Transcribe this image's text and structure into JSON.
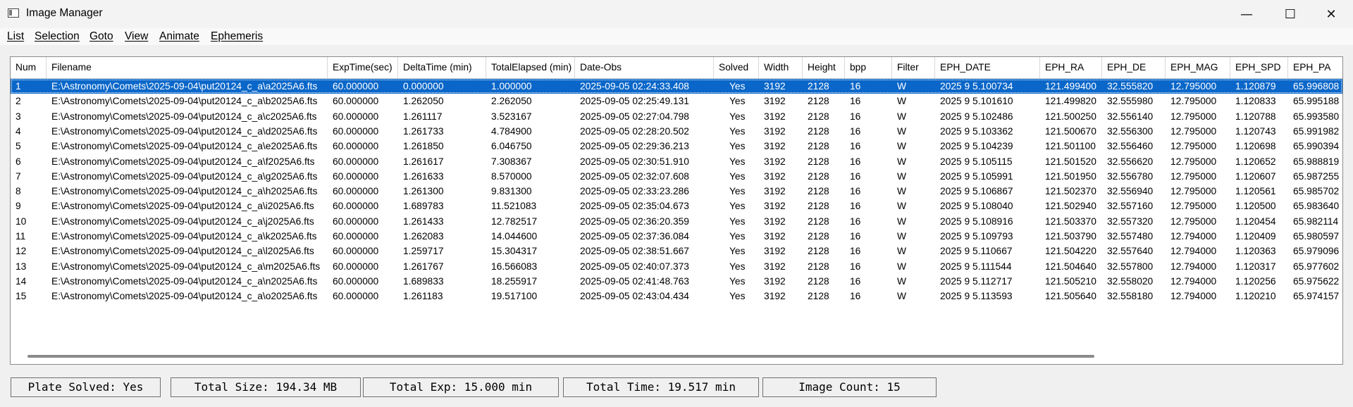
{
  "window": {
    "title": "Image Manager",
    "controls": [
      "—",
      "☐",
      "✕"
    ]
  },
  "menu": [
    "List",
    "Selection",
    "Goto",
    "View",
    "Animate",
    "Ephemeris"
  ],
  "table": {
    "columns": [
      "Num",
      "Filename",
      "ExpTime(sec)",
      "DeltaTime (min)",
      "TotalElapsed (min)",
      "Date-Obs",
      "Solved",
      "Width",
      "Height",
      "bpp",
      "Filter",
      "EPH_DATE",
      "EPH_RA",
      "EPH_DE",
      "EPH_MAG",
      "EPH_SPD",
      "EPH_PA"
    ],
    "selected_row": 0,
    "rows": [
      [
        "1",
        "E:\\Astronomy\\Comets\\2025-09-04\\put20124_c_a\\a2025A6.fts",
        "60.000000",
        "0.000000",
        "1.000000",
        "2025-09-05 02:24:33.408",
        "Yes",
        "3192",
        "2128",
        "16",
        "W",
        "2025 9 5.100734",
        "121.499400",
        "32.555820",
        "12.795000",
        "1.120879",
        "65.996808"
      ],
      [
        "2",
        "E:\\Astronomy\\Comets\\2025-09-04\\put20124_c_a\\b2025A6.fts",
        "60.000000",
        "1.262050",
        "2.262050",
        "2025-09-05 02:25:49.131",
        "Yes",
        "3192",
        "2128",
        "16",
        "W",
        "2025 9 5.101610",
        "121.499820",
        "32.555980",
        "12.795000",
        "1.120833",
        "65.995188"
      ],
      [
        "3",
        "E:\\Astronomy\\Comets\\2025-09-04\\put20124_c_a\\c2025A6.fts",
        "60.000000",
        "1.261117",
        "3.523167",
        "2025-09-05 02:27:04.798",
        "Yes",
        "3192",
        "2128",
        "16",
        "W",
        "2025 9 5.102486",
        "121.500250",
        "32.556140",
        "12.795000",
        "1.120788",
        "65.993580"
      ],
      [
        "4",
        "E:\\Astronomy\\Comets\\2025-09-04\\put20124_c_a\\d2025A6.fts",
        "60.000000",
        "1.261733",
        "4.784900",
        "2025-09-05 02:28:20.502",
        "Yes",
        "3192",
        "2128",
        "16",
        "W",
        "2025 9 5.103362",
        "121.500670",
        "32.556300",
        "12.795000",
        "1.120743",
        "65.991982"
      ],
      [
        "5",
        "E:\\Astronomy\\Comets\\2025-09-04\\put20124_c_a\\e2025A6.fts",
        "60.000000",
        "1.261850",
        "6.046750",
        "2025-09-05 02:29:36.213",
        "Yes",
        "3192",
        "2128",
        "16",
        "W",
        "2025 9 5.104239",
        "121.501100",
        "32.556460",
        "12.795000",
        "1.120698",
        "65.990394"
      ],
      [
        "6",
        "E:\\Astronomy\\Comets\\2025-09-04\\put20124_c_a\\f2025A6.fts",
        "60.000000",
        "1.261617",
        "7.308367",
        "2025-09-05 02:30:51.910",
        "Yes",
        "3192",
        "2128",
        "16",
        "W",
        "2025 9 5.105115",
        "121.501520",
        "32.556620",
        "12.795000",
        "1.120652",
        "65.988819"
      ],
      [
        "7",
        "E:\\Astronomy\\Comets\\2025-09-04\\put20124_c_a\\g2025A6.fts",
        "60.000000",
        "1.261633",
        "8.570000",
        "2025-09-05 02:32:07.608",
        "Yes",
        "3192",
        "2128",
        "16",
        "W",
        "2025 9 5.105991",
        "121.501950",
        "32.556780",
        "12.795000",
        "1.120607",
        "65.987255"
      ],
      [
        "8",
        "E:\\Astronomy\\Comets\\2025-09-04\\put20124_c_a\\h2025A6.fts",
        "60.000000",
        "1.261300",
        "9.831300",
        "2025-09-05 02:33:23.286",
        "Yes",
        "3192",
        "2128",
        "16",
        "W",
        "2025 9 5.106867",
        "121.502370",
        "32.556940",
        "12.795000",
        "1.120561",
        "65.985702"
      ],
      [
        "9",
        "E:\\Astronomy\\Comets\\2025-09-04\\put20124_c_a\\i2025A6.fts",
        "60.000000",
        "1.689783",
        "11.521083",
        "2025-09-05 02:35:04.673",
        "Yes",
        "3192",
        "2128",
        "16",
        "W",
        "2025 9 5.108040",
        "121.502940",
        "32.557160",
        "12.795000",
        "1.120500",
        "65.983640"
      ],
      [
        "10",
        "E:\\Astronomy\\Comets\\2025-09-04\\put20124_c_a\\j2025A6.fts",
        "60.000000",
        "1.261433",
        "12.782517",
        "2025-09-05 02:36:20.359",
        "Yes",
        "3192",
        "2128",
        "16",
        "W",
        "2025 9 5.108916",
        "121.503370",
        "32.557320",
        "12.795000",
        "1.120454",
        "65.982114"
      ],
      [
        "11",
        "E:\\Astronomy\\Comets\\2025-09-04\\put20124_c_a\\k2025A6.fts",
        "60.000000",
        "1.262083",
        "14.044600",
        "2025-09-05 02:37:36.084",
        "Yes",
        "3192",
        "2128",
        "16",
        "W",
        "2025 9 5.109793",
        "121.503790",
        "32.557480",
        "12.794000",
        "1.120409",
        "65.980597"
      ],
      [
        "12",
        "E:\\Astronomy\\Comets\\2025-09-04\\put20124_c_a\\l2025A6.fts",
        "60.000000",
        "1.259717",
        "15.304317",
        "2025-09-05 02:38:51.667",
        "Yes",
        "3192",
        "2128",
        "16",
        "W",
        "2025 9 5.110667",
        "121.504220",
        "32.557640",
        "12.794000",
        "1.120363",
        "65.979096"
      ],
      [
        "13",
        "E:\\Astronomy\\Comets\\2025-09-04\\put20124_c_a\\m2025A6.fts",
        "60.000000",
        "1.261767",
        "16.566083",
        "2025-09-05 02:40:07.373",
        "Yes",
        "3192",
        "2128",
        "16",
        "W",
        "2025 9 5.111544",
        "121.504640",
        "32.557800",
        "12.794000",
        "1.120317",
        "65.977602"
      ],
      [
        "14",
        "E:\\Astronomy\\Comets\\2025-09-04\\put20124_c_a\\n2025A6.fts",
        "60.000000",
        "1.689833",
        "18.255917",
        "2025-09-05 02:41:48.763",
        "Yes",
        "3192",
        "2128",
        "16",
        "W",
        "2025 9 5.112717",
        "121.505210",
        "32.558020",
        "12.794000",
        "1.120256",
        "65.975622"
      ],
      [
        "15",
        "E:\\Astronomy\\Comets\\2025-09-04\\put20124_c_a\\o2025A6.fts",
        "60.000000",
        "1.261183",
        "19.517100",
        "2025-09-05 02:43:04.434",
        "Yes",
        "3192",
        "2128",
        "16",
        "W",
        "2025 9 5.113593",
        "121.505640",
        "32.558180",
        "12.794000",
        "1.120210",
        "65.974157"
      ]
    ]
  },
  "status": [
    "Plate Solved: Yes",
    "Total Size: 194.34 MB",
    "Total Exp: 15.000 min",
    "Total Time: 19.517 min",
    "Image Count: 15"
  ],
  "colors": {
    "selection": "#0a67c9",
    "window_bg": "#f0f0f0",
    "grid_bg": "#ffffff"
  }
}
